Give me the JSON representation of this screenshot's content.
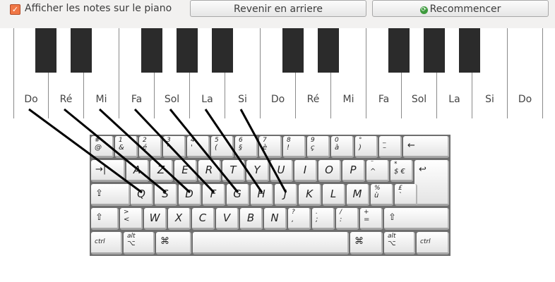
{
  "toolbar": {
    "checkbox_label": "Afficher les notes sur le piano",
    "checkbox_checked": true,
    "back_button": "Revenir en arriere",
    "restart_button": "Recommencer"
  },
  "piano": {
    "white_keys": [
      "Do",
      "Ré",
      "Mi",
      "Fa",
      "Sol",
      "La",
      "Si",
      "Do",
      "Ré",
      "Mi",
      "Fa",
      "Sol",
      "La",
      "Si",
      "Do"
    ]
  },
  "keyboard": {
    "row1": [
      {
        "t": "#",
        "b": "@"
      },
      {
        "t": "1",
        "b": "&"
      },
      {
        "t": "2",
        "b": "é"
      },
      {
        "t": "3",
        "b": "\""
      },
      {
        "t": "4",
        "b": "'"
      },
      {
        "t": "5",
        "b": "("
      },
      {
        "t": "6",
        "b": "§"
      },
      {
        "t": "7",
        "b": "è"
      },
      {
        "t": "8",
        "b": "!"
      },
      {
        "t": "9",
        "b": "ç"
      },
      {
        "t": "0",
        "b": "à"
      },
      {
        "t": "°",
        "b": ")"
      },
      {
        "t": "_",
        "b": "–"
      }
    ],
    "row1_backspace": "←",
    "tab": "→|",
    "row2": [
      "A",
      "Z",
      "E",
      "R",
      "T",
      "Y",
      "U",
      "I",
      "O",
      "P"
    ],
    "row2_extra": [
      {
        "t": "¨",
        "b": "^"
      },
      {
        "t": "*",
        "b": "$ €"
      }
    ],
    "enter": "↩",
    "capslock": "⇪",
    "row3": [
      "Q",
      "S",
      "D",
      "F",
      "G",
      "H",
      "J",
      "K",
      "L",
      "M"
    ],
    "row3_extra": [
      {
        "t": "%",
        "b": "ù"
      },
      {
        "t": "£",
        "b": "`"
      }
    ],
    "shift_left": "⇧",
    "row4_lt": {
      "t": ">",
      "b": "<"
    },
    "row4": [
      "W",
      "X",
      "C",
      "V",
      "B",
      "N"
    ],
    "row4_extra": [
      {
        "t": "?",
        "b": ","
      },
      {
        "t": ".",
        "b": ";"
      },
      {
        "t": "/",
        "b": ":"
      },
      {
        "t": "+",
        "b": "="
      }
    ],
    "shift_right": "⇧",
    "ctrl": "ctrl",
    "alt_top": "alt",
    "alt_sym": "⌥",
    "cmd": " ⌘",
    "apple": "",
    "mapping": [
      {
        "note": "Do",
        "key": "Q"
      },
      {
        "note": "Ré",
        "key": "S"
      },
      {
        "note": "Mi",
        "key": "D"
      },
      {
        "note": "Fa",
        "key": "F"
      },
      {
        "note": "Sol",
        "key": "G"
      },
      {
        "note": "La",
        "key": "H"
      },
      {
        "note": "Si",
        "key": "J"
      }
    ]
  }
}
